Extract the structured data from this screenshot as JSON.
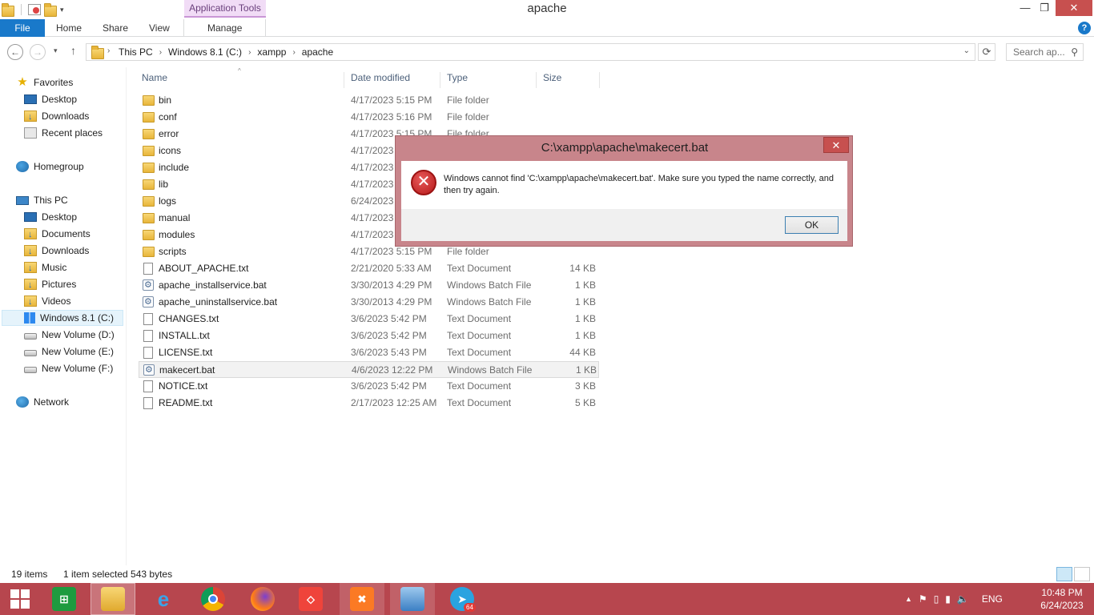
{
  "window": {
    "title": "apache"
  },
  "ribbon": {
    "context_label": "Application Tools",
    "tabs": [
      {
        "label": "File"
      },
      {
        "label": "Home"
      },
      {
        "label": "Share"
      },
      {
        "label": "View"
      },
      {
        "label": "Manage"
      }
    ]
  },
  "address": {
    "crumbs": [
      "This PC",
      "Windows 8.1  (C:)",
      "xampp",
      "apache"
    ],
    "search_placeholder": "Search ap..."
  },
  "nav": {
    "favorites": "Favorites",
    "fav_items": [
      "Desktop",
      "Downloads",
      "Recent places"
    ],
    "homegroup": "Homegroup",
    "thispc": "This PC",
    "pc_items": [
      "Desktop",
      "Documents",
      "Downloads",
      "Music",
      "Pictures",
      "Videos",
      "Windows 8.1  (C:)",
      "New Volume (D:)",
      "New Volume (E:)",
      "New Volume (F:)"
    ],
    "network": "Network"
  },
  "columns": {
    "name": "Name",
    "date": "Date modified",
    "type": "Type",
    "size": "Size"
  },
  "files": [
    {
      "name": "bin",
      "date": "4/17/2023 5:15 PM",
      "type": "File folder",
      "size": ""
    },
    {
      "name": "conf",
      "date": "4/17/2023 5:16 PM",
      "type": "File folder",
      "size": ""
    },
    {
      "name": "error",
      "date": "4/17/2023 5:15 PM",
      "type": "File folder",
      "size": ""
    },
    {
      "name": "icons",
      "date": "4/17/2023",
      "type": "",
      "size": ""
    },
    {
      "name": "include",
      "date": "4/17/2023",
      "type": "",
      "size": ""
    },
    {
      "name": "lib",
      "date": "4/17/2023",
      "type": "",
      "size": ""
    },
    {
      "name": "logs",
      "date": "6/24/2023",
      "type": "",
      "size": ""
    },
    {
      "name": "manual",
      "date": "4/17/2023",
      "type": "",
      "size": ""
    },
    {
      "name": "modules",
      "date": "4/17/2023",
      "type": "",
      "size": ""
    },
    {
      "name": "scripts",
      "date": "4/17/2023 5:15 PM",
      "type": "File folder",
      "size": ""
    },
    {
      "name": "ABOUT_APACHE.txt",
      "date": "2/21/2020 5:33 AM",
      "type": "Text Document",
      "size": "14 KB"
    },
    {
      "name": "apache_installservice.bat",
      "date": "3/30/2013 4:29 PM",
      "type": "Windows Batch File",
      "size": "1 KB"
    },
    {
      "name": "apache_uninstallservice.bat",
      "date": "3/30/2013 4:29 PM",
      "type": "Windows Batch File",
      "size": "1 KB"
    },
    {
      "name": "CHANGES.txt",
      "date": "3/6/2023 5:42 PM",
      "type": "Text Document",
      "size": "1 KB"
    },
    {
      "name": "INSTALL.txt",
      "date": "3/6/2023 5:42 PM",
      "type": "Text Document",
      "size": "1 KB"
    },
    {
      "name": "LICENSE.txt",
      "date": "3/6/2023 5:43 PM",
      "type": "Text Document",
      "size": "44 KB"
    },
    {
      "name": "makecert.bat",
      "date": "4/6/2023 12:22 PM",
      "type": "Windows Batch File",
      "size": "1 KB"
    },
    {
      "name": "NOTICE.txt",
      "date": "3/6/2023 5:42 PM",
      "type": "Text Document",
      "size": "3 KB"
    },
    {
      "name": "README.txt",
      "date": "2/17/2023 12:25 AM",
      "type": "Text Document",
      "size": "5 KB"
    }
  ],
  "status": {
    "count": "19 items",
    "selection": "1 item selected  543 bytes"
  },
  "dialog": {
    "title": "C:\\xampp\\apache\\makecert.bat",
    "message": "Windows cannot find 'C:\\xampp\\apache\\makecert.bat'. Make sure you typed the name correctly, and then try again.",
    "ok_label": "OK"
  },
  "taskbar": {
    "lang": "ENG",
    "time": "10:48 PM",
    "date": "6/24/2023",
    "badge": "64"
  },
  "colors": {
    "taskbar": "#b7464e",
    "file_tab": "#1979ca",
    "context_tab": "#f1dcf6",
    "dialog_frame": "#c8858b",
    "close": "#c7504f"
  }
}
